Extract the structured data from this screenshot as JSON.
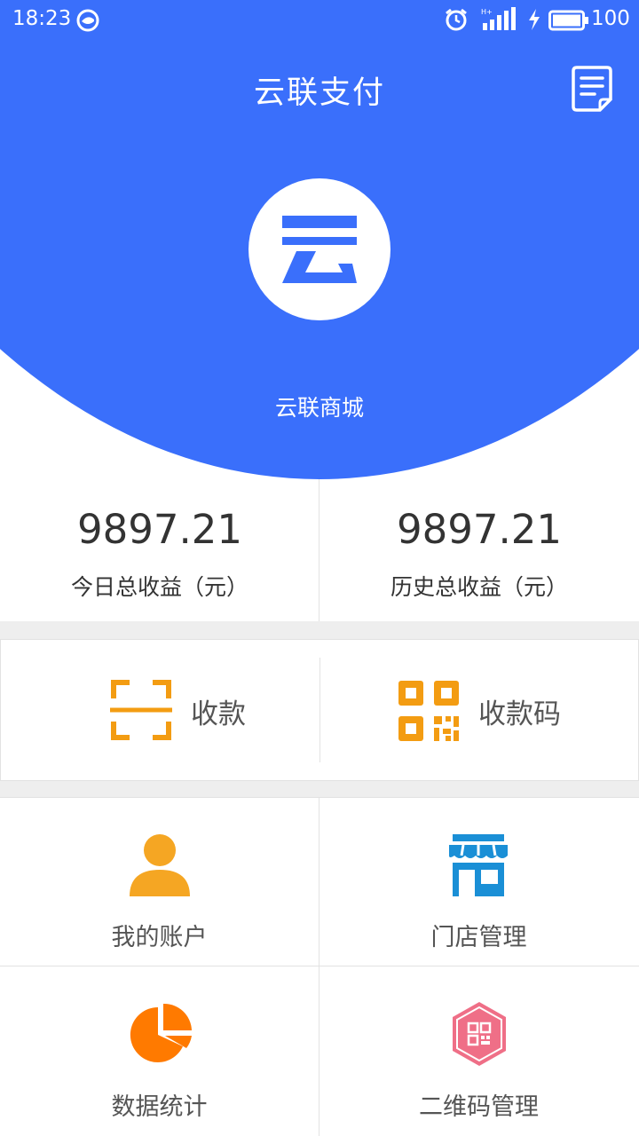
{
  "status_bar": {
    "time": "18:23",
    "battery_level": "100",
    "icons": [
      "notification-icon",
      "alarm-icon",
      "signal-icon",
      "charging-icon",
      "battery-icon"
    ]
  },
  "header": {
    "title": "云联支付",
    "right_icon": "receipt-icon",
    "store_name": "云联商城",
    "logo_icon": "yun-logo"
  },
  "stats": {
    "today": {
      "value": "9897.21",
      "label": "今日总收益（元）"
    },
    "history": {
      "value": "9897.21",
      "label": "历史总收益（元）"
    }
  },
  "actions": [
    {
      "label": "收款",
      "icon": "scan-icon"
    },
    {
      "label": "收款码",
      "icon": "qr-code-icon"
    }
  ],
  "menu": [
    {
      "label": "我的账户",
      "icon": "user-icon"
    },
    {
      "label": "门店管理",
      "icon": "store-icon"
    },
    {
      "label": "数据统计",
      "icon": "pie-chart-icon"
    },
    {
      "label": "二维码管理",
      "icon": "qr-manage-icon"
    }
  ],
  "colors": {
    "primary": "#3a6ffb",
    "accent_orange": "#f39c12",
    "store_blue": "#1a8fd6",
    "chart_orange": "#ff7a00",
    "qr_pink": "#ef6f87"
  }
}
